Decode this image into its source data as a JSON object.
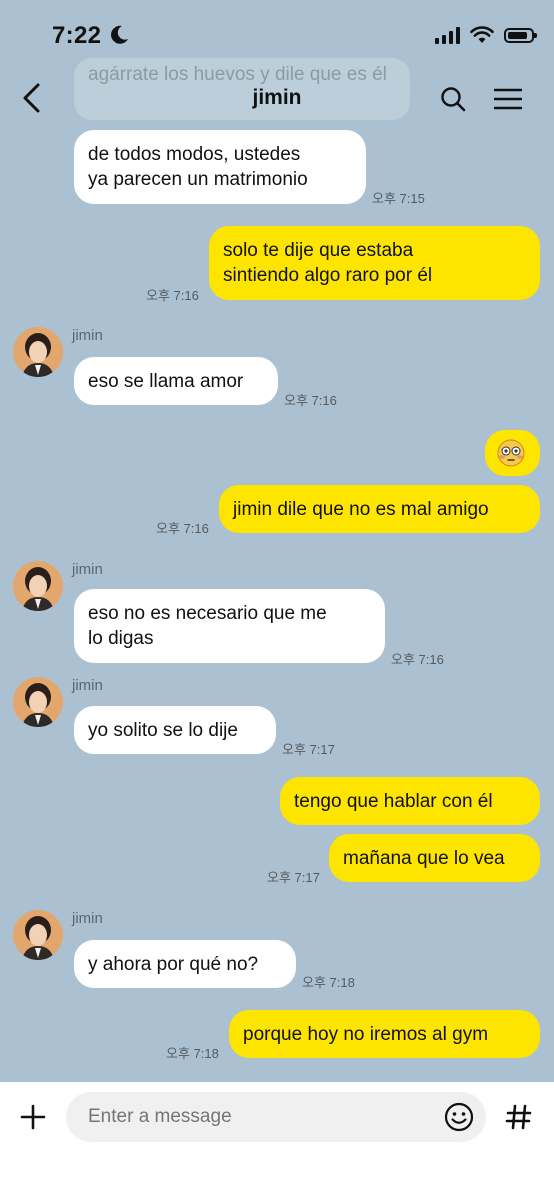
{
  "status_bar": {
    "time": "7:22"
  },
  "header": {
    "title": "jimin",
    "ghost_text": "agárrate los huevos y dile que es él"
  },
  "messages": [
    {
      "side": "in",
      "text_lines": [
        "de todos modos, ustedes",
        "ya parecen un matrimonio"
      ],
      "time": "오후 7:15"
    },
    {
      "side": "out",
      "text_lines": [
        "solo te dije que estaba",
        "sintiendo algo raro por él"
      ],
      "time": "오후 7:16"
    },
    {
      "side": "in",
      "sender": "jimin",
      "text_lines": [
        "eso se llama amor"
      ],
      "time": "오후 7:16"
    },
    {
      "side": "out",
      "emoji": "flushed-emoji"
    },
    {
      "side": "out",
      "text_lines": [
        "jimin dile que no es mal amigo"
      ],
      "time": "오후 7:16"
    },
    {
      "side": "in",
      "sender": "jimin",
      "text_lines": [
        "eso no es necesario que me",
        "lo digas"
      ],
      "time": "오후 7:16"
    },
    {
      "side": "in",
      "sender": "jimin",
      "text_lines": [
        "yo solito se lo dije"
      ],
      "time": "오후 7:17"
    },
    {
      "side": "out",
      "text_lines": [
        "tengo que hablar con él"
      ]
    },
    {
      "side": "out",
      "text_lines": [
        "mañana que lo vea"
      ],
      "time": "오후 7:17"
    },
    {
      "side": "in",
      "sender": "jimin",
      "text_lines": [
        "y ahora por qué no?"
      ],
      "time": "오후 7:18"
    },
    {
      "side": "out",
      "text_lines": [
        "porque hoy no iremos al gym"
      ],
      "time": "오후 7:18"
    }
  ],
  "composer": {
    "placeholder": "Enter a message"
  },
  "colors": {
    "background": "#abc1d1",
    "outgoing_bubble": "#fee500",
    "incoming_bubble": "#ffffff"
  }
}
